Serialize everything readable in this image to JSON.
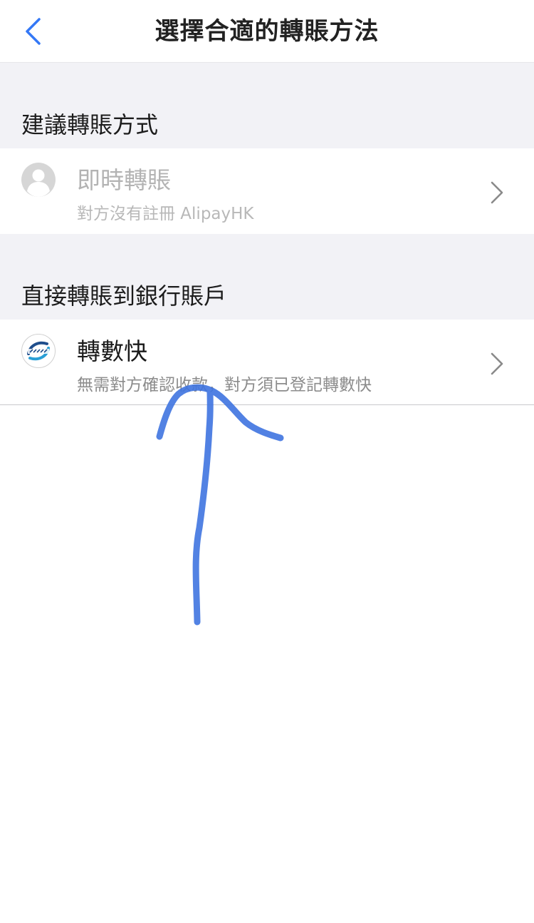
{
  "navbar": {
    "title": "選擇合適的轉賬方法"
  },
  "sections": [
    {
      "header": "建議轉賬方式",
      "item": {
        "title": "即時轉賬",
        "subtitle": "對方沒有註冊 AlipayHK",
        "icon": "user-avatar-icon",
        "disabled": true
      }
    },
    {
      "header": "直接轉賬到銀行賬戶",
      "item": {
        "title": "轉數快",
        "subtitle": "無需對方確認收款，對方須已登記轉數快",
        "icon": "fps-logo-icon",
        "disabled": false
      }
    }
  ],
  "colors": {
    "accent": "#3478f6",
    "annotation_arrow": "#3f74e0",
    "section_bg": "#f2f2f6"
  }
}
